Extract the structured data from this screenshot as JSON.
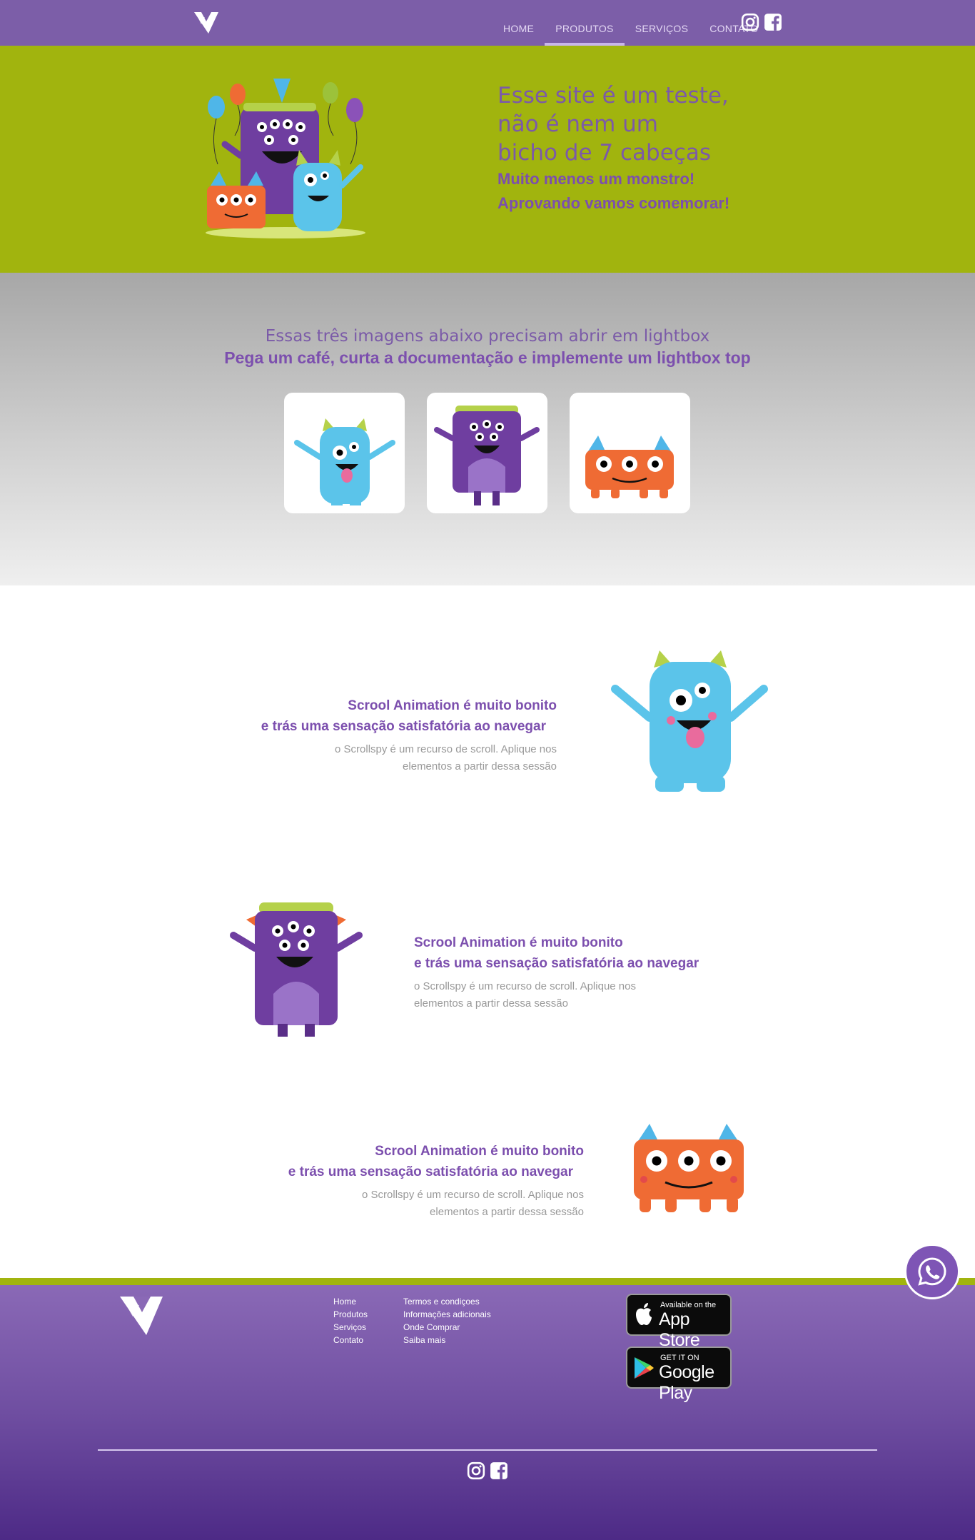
{
  "nav": {
    "items": [
      {
        "label": "HOME"
      },
      {
        "label": "PRODUTOS"
      },
      {
        "label": "SERVIÇOS"
      },
      {
        "label": "CONTATO"
      }
    ],
    "active_index": 1
  },
  "hero": {
    "line1": "Esse site é um teste,",
    "line2": "não é nem um",
    "line3": "bicho de 7 cabeças",
    "bold1": "Muito menos um monstro!",
    "bold2": "Aprovando vamos comemorar!"
  },
  "gallery": {
    "subtitle": "Essas três imagens abaixo precisam abrir em lightbox",
    "title": "Pega um café, curta a documentação e implemente um lightbox top"
  },
  "features": [
    {
      "title1": "Scrool Animation é muito bonito",
      "title2": "e trás uma sensação satisfatória ao navegar",
      "text1": "o Scrollspy é um recurso de scroll. Aplique nos",
      "text2": "elementos a partir dessa sessão"
    },
    {
      "title1": "Scrool Animation é muito bonito",
      "title2": "e trás uma sensação satisfatória ao navegar",
      "text1": "o Scrollspy é um recurso de scroll. Aplique nos",
      "text2": "elementos a partir dessa sessão"
    },
    {
      "title1": "Scrool Animation é muito bonito",
      "title2": "e trás uma sensação satisfatória ao navegar",
      "text1": "o Scrollspy é um recurso de scroll. Aplique nos",
      "text2": "elementos a partir dessa sessão"
    }
  ],
  "footer": {
    "col1": [
      "Home",
      "Produtos",
      "Serviços",
      "Contato"
    ],
    "col2": [
      "Termos e condiçoes",
      "Informações adicionais",
      "Onde Comprar",
      "Saiba mais"
    ],
    "appstore_small": "Available on the",
    "appstore_big": "App Store",
    "googleplay_small": "GET IT ON",
    "googleplay_big": "Google Play"
  },
  "colors": {
    "nav_purple": "#7c5ea8",
    "hero_green": "#a1b40e",
    "title_purple": "#7c4fae",
    "text_gray": "#999999"
  },
  "icons": [
    "logo-icon",
    "instagram-icon",
    "facebook-icon",
    "apple-icon",
    "google-play-icon",
    "whatsapp-icon"
  ]
}
